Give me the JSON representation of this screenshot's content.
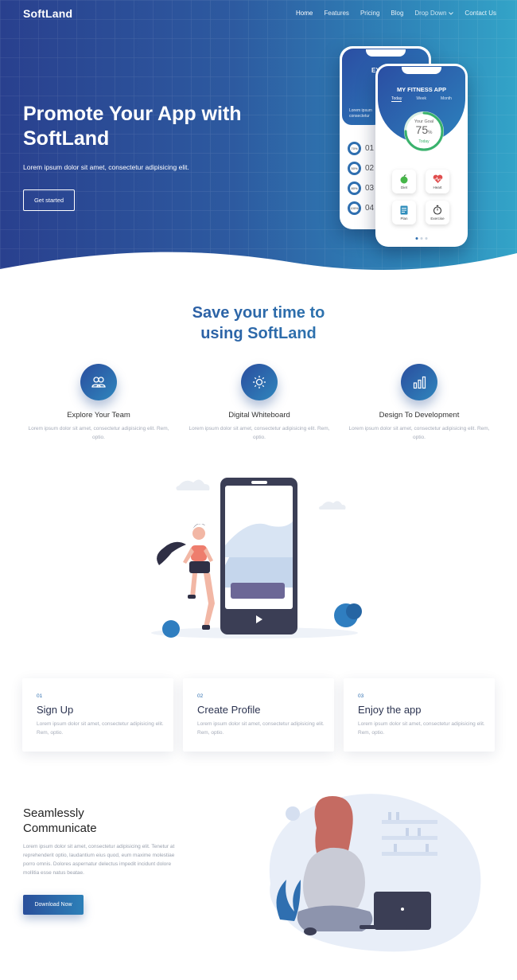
{
  "brand": "SoftLand",
  "nav": {
    "items": [
      "Home",
      "Features",
      "Pricing",
      "Blog"
    ],
    "dropdown": "Drop Down",
    "contact": "Contact Us"
  },
  "hero": {
    "title": "Promote Your App with SoftLand",
    "lead": "Lorem ipsum dolor sit amet, consectetur adipisicing elit.",
    "cta": "Get started"
  },
  "mockup_back": {
    "title": "EX",
    "lorem": "Lorem ipsum\nconsectetur",
    "rows": [
      {
        "pct": "70%",
        "num": "01"
      },
      {
        "pct": "50%",
        "num": "02"
      },
      {
        "pct": "80%",
        "num": "03"
      },
      {
        "pct": "100%",
        "num": "04"
      }
    ]
  },
  "mockup_front": {
    "app_title": "MY FITNESS APP",
    "tabs": [
      "Today",
      "Week",
      "Month"
    ],
    "goal_label": "Your Goal",
    "goal_value": "75",
    "goal_unit": "%",
    "goal_sub": "Today",
    "goal_progress": 0.75,
    "tiles": [
      "Diet",
      "Heart",
      "Plan",
      "Exercise"
    ]
  },
  "section": {
    "title_line1": "Save your time to",
    "title_line2": "using SoftLand"
  },
  "features": [
    {
      "icon": "team-icon",
      "title": "Explore Your Team",
      "desc": "Lorem ipsum dolor sit amet, consectetur adipisicing elit. Rem, optio."
    },
    {
      "icon": "sun-icon",
      "title": "Digital Whiteboard",
      "desc": "Lorem ipsum dolor sit amet, consectetur adipisicing elit. Rem, optio."
    },
    {
      "icon": "bar-chart-icon",
      "title": "Design To Development",
      "desc": "Lorem ipsum dolor sit amet, consectetur adipisicing elit. Rem, optio."
    }
  ],
  "steps": [
    {
      "num": "01",
      "title": "Sign Up",
      "desc": "Lorem ipsum dolor sit amet, consectetur adipisicing elit. Rem, optio."
    },
    {
      "num": "02",
      "title": "Create Profile",
      "desc": "Lorem ipsum dolor sit amet, consectetur adipisicing elit. Rem, optio."
    },
    {
      "num": "03",
      "title": "Enjoy the app",
      "desc": "Lorem ipsum dolor sit amet, consectetur adipisicing elit. Rem, optio."
    }
  ],
  "communicate": {
    "title_line1": "Seamlessly",
    "title_line2": "Communicate",
    "desc": "Lorem ipsum dolor sit amet, consectetur adipisicing elit. Tenetur at reprehenderit optio, laudantium eius quod, eum maxime molestiae porro omnis. Dolores aspernatur delectus impedit incidunt dolore mollitia esse natus beatae.",
    "cta": "Download Now"
  },
  "colors": {
    "primary_dark": "#29408e",
    "primary_light": "#33a4c8",
    "accent_green": "#39b26c"
  }
}
